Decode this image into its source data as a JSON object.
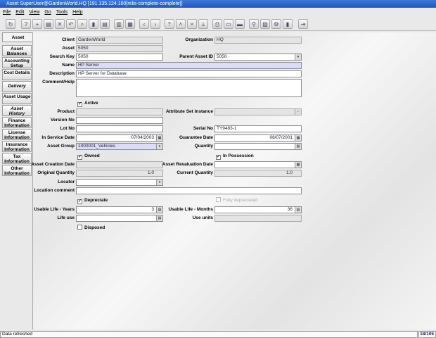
{
  "window": {
    "title": "Asset SuperUser@GardenWorld.HQ [191.135.124.100[relis-complete-complete]]"
  },
  "menu": [
    "File",
    "Edit",
    "View",
    "Go",
    "Tools",
    "Help"
  ],
  "toolbar": [
    "refresh-icon",
    "help-icon",
    "new-icon",
    "copy-icon",
    "delete-icon",
    "undo-icon",
    "find-icon",
    "history-icon",
    "report-icon",
    "parent-icon",
    "detail-icon",
    "prev-icon",
    "next-icon",
    "first-icon",
    "up-icon",
    "down-icon",
    "last-icon",
    "print-icon",
    "print-preview-icon",
    "attachment-icon",
    "zoom-icon",
    "archive-icon",
    "workflow-icon",
    "book-icon",
    "exit-icon"
  ],
  "tabs": [
    "Asset",
    "Asset Balances",
    "Accounting Setup",
    "Cost Details",
    "Delivery",
    "Asset Usage",
    "Asset History",
    "Finance Information",
    "License Information",
    "Insurance Information",
    "Tax Information",
    "Other Information"
  ],
  "form": {
    "client": {
      "label": "Client",
      "value": "GardenWorld"
    },
    "organization": {
      "label": "Organization",
      "value": "HQ"
    },
    "asset": {
      "label": "Asset",
      "value": "5050"
    },
    "search_key": {
      "label": "Search Key",
      "value": "5050"
    },
    "parent_asset": {
      "label": "Parent Asset ID",
      "value": "5050"
    },
    "name": {
      "label": "Name",
      "value": "HP Server"
    },
    "description": {
      "label": "Description",
      "value": "HP Server for Database"
    },
    "comment": {
      "label": "Comment/Help",
      "value": ""
    },
    "active": {
      "label": "Active",
      "checked": true
    },
    "product": {
      "label": "Product",
      "value": ""
    },
    "attribute": {
      "label": "Attribute Set Instance",
      "value": ""
    },
    "version": {
      "label": "Version No",
      "value": ""
    },
    "lot": {
      "label": "Lot No",
      "value": ""
    },
    "serial": {
      "label": "Serial No",
      "value": "TY9483-1"
    },
    "in_service": {
      "label": "In Service Date",
      "value": "07/04/2003"
    },
    "guarantee": {
      "label": "Guarantee Date",
      "value": "08/07/2001"
    },
    "asset_group": {
      "label": "Asset Group",
      "value": "1000001_Vehicles"
    },
    "quantity": {
      "label": "Quantity",
      "value": ""
    },
    "owned": {
      "label": "Owned",
      "checked": true
    },
    "in_possession": {
      "label": "In Possession",
      "checked": true
    },
    "creation_date": {
      "label": "Asset Creation Date",
      "value": ""
    },
    "revaluation_date": {
      "label": "Asset Revaluation Date",
      "value": ""
    },
    "orig_qty": {
      "label": "Original Quantity",
      "value": "1.0"
    },
    "current_qty": {
      "label": "Current Quantity",
      "value": "1.0"
    },
    "locator": {
      "label": "Locator",
      "value": ""
    },
    "location_comment": {
      "label": "Location comment",
      "value": ""
    },
    "depreciate": {
      "label": "Depreciate",
      "checked": true
    },
    "fully_depreciated": {
      "label": "Fully depreciated",
      "checked": false
    },
    "life_years": {
      "label": "Usable Life - Years",
      "value": "3"
    },
    "life_months": {
      "label": "Usable Life - Months",
      "value": "36"
    },
    "life_use": {
      "label": "Life use",
      "value": ""
    },
    "use_units": {
      "label": "Use units",
      "value": ""
    },
    "disposed": {
      "label": "Disposed",
      "checked": false
    }
  },
  "status": {
    "message": "Data refreshed",
    "record": "18/105"
  }
}
